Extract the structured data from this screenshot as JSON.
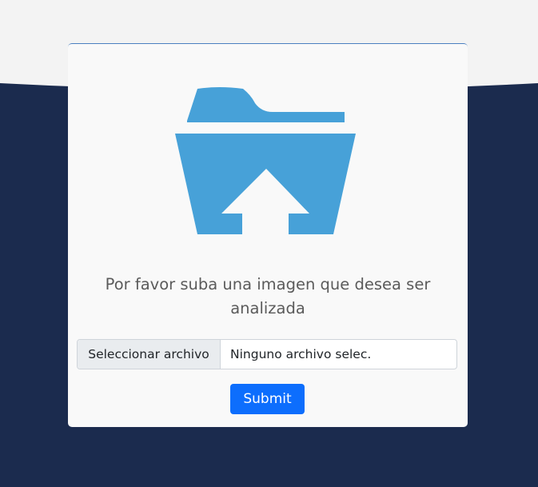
{
  "upload": {
    "icon": "folder-upload-icon",
    "prompt": "Por favor suba una imagen que desea ser analizada",
    "file_button_label": "Seleccionar archivo",
    "file_status": "Ninguno archivo selec.",
    "submit_label": "Submit"
  },
  "colors": {
    "background_top": "#f3f3f3",
    "background_bottom": "#1b2b4e",
    "card": "#f9f9f9",
    "icon": "#47a1d8",
    "submit": "#0d6efd"
  }
}
